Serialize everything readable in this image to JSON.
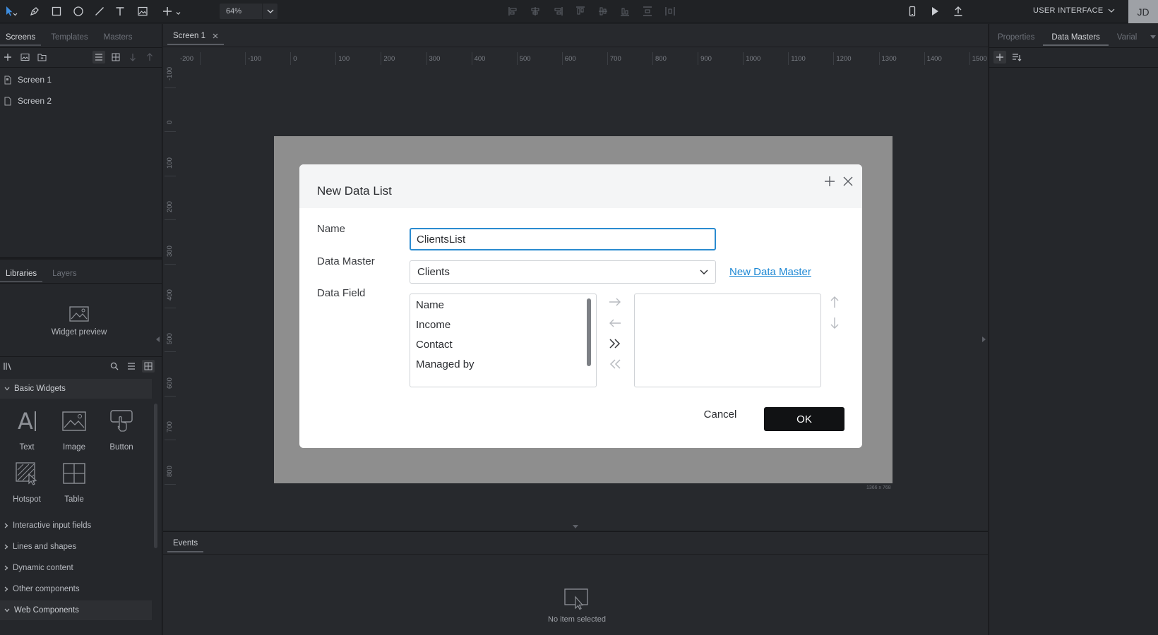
{
  "toolbar": {
    "zoom": "64%",
    "mode_label": "USER INTERFACE",
    "avatar_initials": "JD"
  },
  "left_panel": {
    "tabs": [
      "Screens",
      "Templates",
      "Masters"
    ],
    "screens": [
      "Screen 1",
      "Screen 2"
    ],
    "lib_tabs": [
      "Libraries",
      "Layers"
    ],
    "widget_preview": "Widget preview",
    "basic_widgets_title": "Basic Widgets",
    "widgets": [
      "Text",
      "Image",
      "Button",
      "Hotspot",
      "Table"
    ],
    "text_widget_glyph": "A",
    "categories": [
      "Interactive input fields",
      "Lines and shapes",
      "Dynamic content",
      "Other components"
    ],
    "web_components_title": "Web Components"
  },
  "canvas": {
    "doc_tab": "Screen 1",
    "ruler_h": [
      "-200",
      "-100",
      "0",
      "100",
      "200",
      "300",
      "400",
      "500",
      "600",
      "700",
      "800",
      "900",
      "1000",
      "1100",
      "1200",
      "1300",
      "1400",
      "1500"
    ],
    "ruler_v": [
      "-100",
      "0",
      "100",
      "200",
      "300",
      "400",
      "500",
      "600",
      "700",
      "800"
    ],
    "artboard_size": "1366 x 768"
  },
  "dialog": {
    "title": "New Data List",
    "name_label": "Name",
    "name_value": "ClientsList",
    "data_master_label": "Data Master",
    "data_master_value": "Clients",
    "new_data_master_link": "New Data Master",
    "data_field_label": "Data Field",
    "available_fields": [
      "Name",
      "Income",
      "Contact",
      "Managed by"
    ],
    "selected_fields": [],
    "cancel_label": "Cancel",
    "ok_label": "OK"
  },
  "events": {
    "tab": "Events",
    "empty_text": "No item selected"
  },
  "right_panel": {
    "tabs": [
      "Properties",
      "Data Masters",
      "Varial"
    ]
  }
}
